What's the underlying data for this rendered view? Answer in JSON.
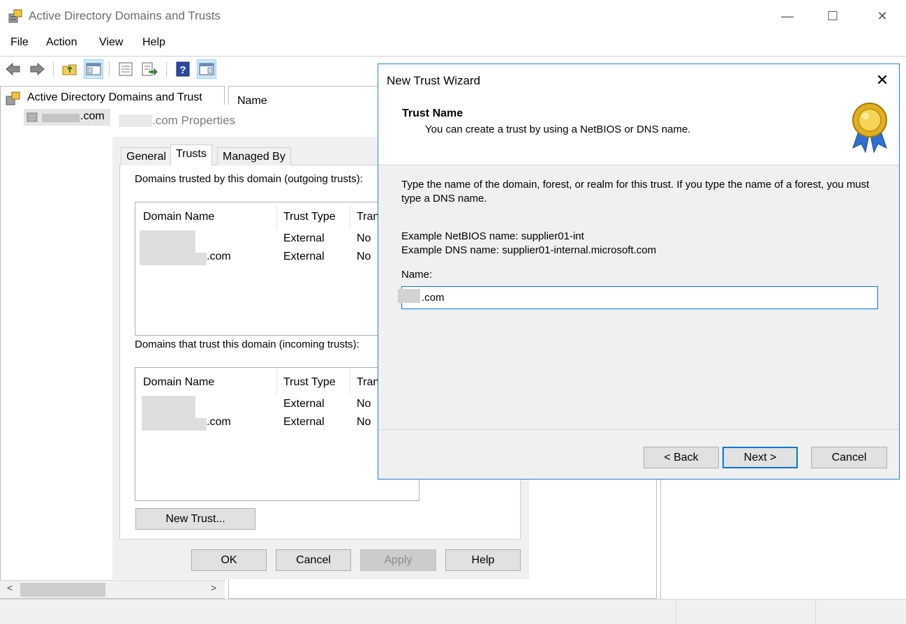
{
  "window": {
    "title": "Active Directory Domains and Trusts",
    "controls": {
      "minimize": "—",
      "maximize": "☐",
      "close": "✕"
    }
  },
  "menu": [
    "File",
    "Action",
    "View",
    "Help"
  ],
  "toolbar_icons": [
    "back-arrow-icon",
    "forward-arrow-icon",
    "up-folder-icon",
    "show-tree-icon",
    "properties-icon",
    "export-list-icon",
    "help-icon",
    "action-pane-icon"
  ],
  "tree": {
    "root_label": "Active Directory Domains and Trust",
    "child_suffix": ".com"
  },
  "list": {
    "column_name": "Name"
  },
  "scrollbar": {
    "left": "<",
    "right": ">"
  },
  "properties": {
    "title_suffix": ".com Properties",
    "tabs": [
      "General",
      "Trusts",
      "Managed By"
    ],
    "active_tab": "Trusts",
    "outgoing": {
      "label": "Domains trusted by this domain (outgoing trusts):",
      "columns": [
        "Domain Name",
        "Trust Type",
        "Tran"
      ],
      "rows": [
        {
          "domain": "",
          "type": "External",
          "transitive": "No"
        },
        {
          "domain": ".com",
          "type": "External",
          "transitive": "No"
        }
      ]
    },
    "incoming": {
      "label": "Domains that trust this domain (incoming trusts):",
      "columns": [
        "Domain Name",
        "Trust Type",
        "Tran"
      ],
      "rows": [
        {
          "domain": "",
          "type": "External",
          "transitive": "No"
        },
        {
          "domain": ".com",
          "type": "External",
          "transitive": "No"
        }
      ]
    },
    "new_trust_button": "New Trust...",
    "buttons": {
      "ok": "OK",
      "cancel": "Cancel",
      "apply": "Apply",
      "help": "Help"
    }
  },
  "wizard": {
    "title": "New Trust Wizard",
    "step_title": "Trust Name",
    "step_subtitle": "You can create a trust by using a NetBIOS or DNS name.",
    "description": "Type the name of the domain, forest, or realm for this trust. If you type the name of a forest, you must type a DNS name.",
    "example_netbios": "Example NetBIOS name: supplier01-int",
    "example_dns": "Example DNS name: supplier01-internal.microsoft.com",
    "name_label": "Name:",
    "name_value": ".com",
    "buttons": {
      "back": "< Back",
      "next": "Next >",
      "cancel": "Cancel"
    },
    "close": "✕"
  },
  "colors": {
    "accent": "#0078d7",
    "dialog_bg": "#f0f0f0"
  }
}
